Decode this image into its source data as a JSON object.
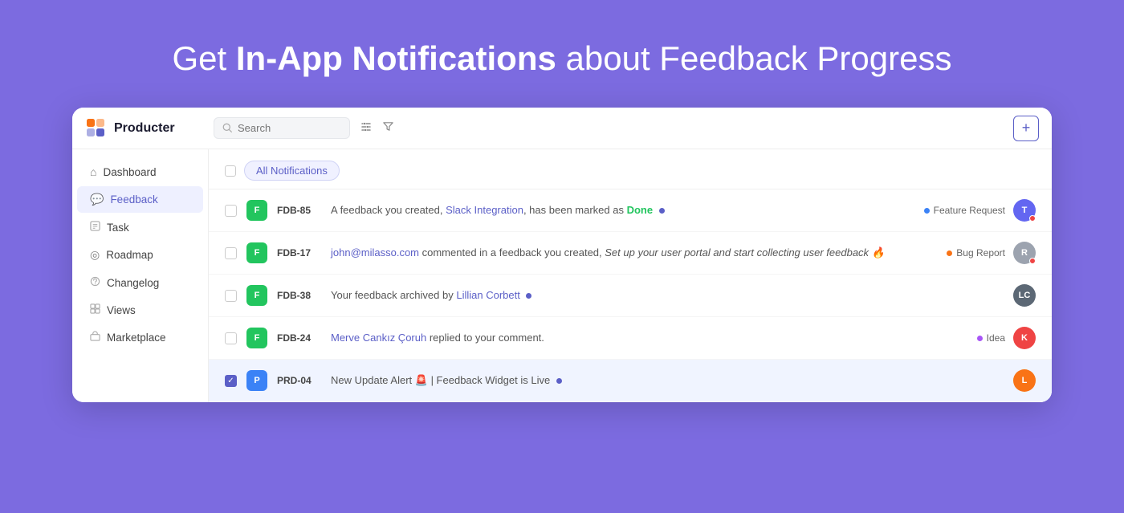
{
  "hero": {
    "title_plain": "Get ",
    "title_bold": "In-App Notifications",
    "title_end": " about Feedback Progress"
  },
  "topbar": {
    "logo_text": "Producter",
    "search_placeholder": "Search",
    "plus_label": "+",
    "filter_icon": "⊞",
    "funnel_icon": "⌽"
  },
  "sidebar": {
    "items": [
      {
        "id": "dashboard",
        "label": "Dashboard",
        "icon": "⌂"
      },
      {
        "id": "feedback",
        "label": "Feedback",
        "icon": "💬"
      },
      {
        "id": "task",
        "label": "Task",
        "icon": "☰"
      },
      {
        "id": "roadmap",
        "label": "Roadmap",
        "icon": "◎"
      },
      {
        "id": "changelog",
        "label": "Changelog",
        "icon": "💬"
      },
      {
        "id": "views",
        "label": "Views",
        "icon": "⊡"
      },
      {
        "id": "marketplace",
        "label": "Marketplace",
        "icon": "🛒"
      }
    ]
  },
  "content": {
    "tab_label": "All Notifications",
    "notifications": [
      {
        "id": "FDB-85",
        "badge_type": "green",
        "badge_text": "F",
        "text_plain": "A feedback you created, ",
        "text_link": "Slack Integration",
        "text_mid": ", has been marked as ",
        "text_status": "Done",
        "text_end": "",
        "has_dot": true,
        "dot_class": "dot",
        "tag": "Feature Request",
        "tag_dot_class": "tag-dot-blue",
        "avatar_class": "avatar-t",
        "avatar_text": "T",
        "checked": false
      },
      {
        "id": "FDB-17",
        "badge_type": "green",
        "badge_text": "F",
        "text_plain": "",
        "text_link": "john@milasso.com",
        "text_mid": " commented in a feedback you created, ",
        "text_status": "Set up your user portal and start collecting user feedback 🔥",
        "text_end": "",
        "has_dot": false,
        "tag": "Bug Report",
        "tag_dot_class": "tag-dot-orange",
        "avatar_class": "avatar-r",
        "avatar_text": "R",
        "checked": false
      },
      {
        "id": "FDB-38",
        "badge_type": "green",
        "badge_text": "F",
        "text_plain": "Your feedback archived by ",
        "text_link": "Lillian Corbett",
        "text_mid": "",
        "text_status": "",
        "text_end": "",
        "has_dot": true,
        "dot_class": "dot",
        "tag": "",
        "tag_dot_class": "",
        "avatar_class": "avatar-img",
        "avatar_text": "LC",
        "checked": false
      },
      {
        "id": "FDB-24",
        "badge_type": "green",
        "badge_text": "F",
        "text_plain": "",
        "text_link": "Merve Cankız Çoruh",
        "text_mid": " replied to your comment.",
        "text_status": "",
        "text_end": "",
        "has_dot": false,
        "tag": "Idea",
        "tag_dot_class": "tag-dot-purple",
        "avatar_class": "avatar-k",
        "avatar_text": "K",
        "checked": false
      },
      {
        "id": "PRD-04",
        "badge_type": "blue",
        "badge_text": "P",
        "text_plain": "New Update Alert 🚨 | Feedback Widget is Live",
        "text_link": "",
        "text_mid": "",
        "text_status": "",
        "text_end": "",
        "has_dot": true,
        "dot_class": "dot",
        "tag": "",
        "tag_dot_class": "",
        "avatar_class": "avatar-l",
        "avatar_text": "L",
        "checked": true
      }
    ]
  }
}
